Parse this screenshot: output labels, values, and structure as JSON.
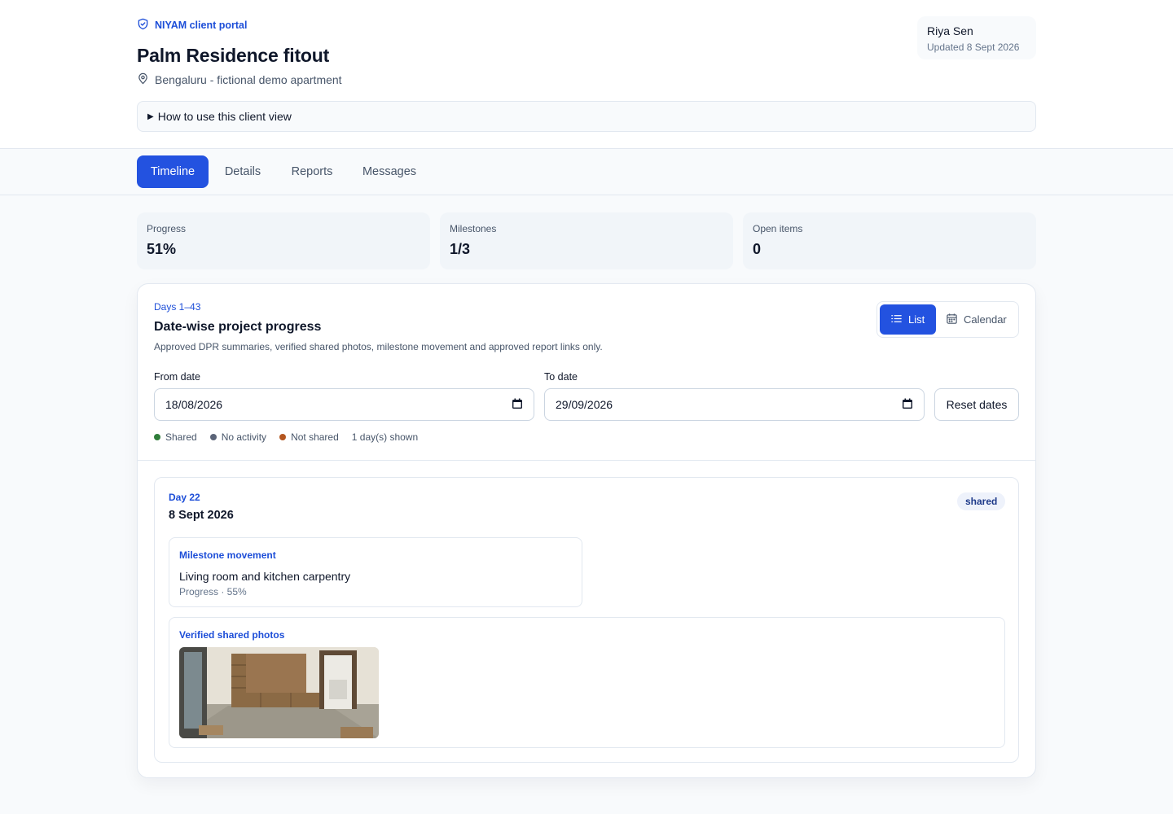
{
  "header": {
    "brand": "NIYAM client portal",
    "project_title": "Palm Residence fitout",
    "location": "Bengaluru - fictional demo apartment",
    "user_name": "Riya Sen",
    "updated": "Updated 8 Sept 2026",
    "howto": "How to use this client view"
  },
  "tabs": [
    {
      "label": "Timeline",
      "active": true
    },
    {
      "label": "Details",
      "active": false
    },
    {
      "label": "Reports",
      "active": false
    },
    {
      "label": "Messages",
      "active": false
    }
  ],
  "stats": [
    {
      "label": "Progress",
      "value": "51%"
    },
    {
      "label": "Milestones",
      "value": "1/3"
    },
    {
      "label": "Open items",
      "value": "0"
    }
  ],
  "panel": {
    "range": "Days 1–43",
    "title": "Date-wise project progress",
    "description": "Approved DPR summaries, verified shared photos, milestone movement and approved report links only.",
    "view_toggle": {
      "list": "List",
      "calendar": "Calendar",
      "selected": "List"
    },
    "from_label": "From date",
    "from_value": "18/08/2026",
    "to_label": "To date",
    "to_value": "29/09/2026",
    "reset_label": "Reset dates",
    "legend": [
      {
        "label": "Shared",
        "color": "#2f7d3a"
      },
      {
        "label": "No activity",
        "color": "#5b6478"
      },
      {
        "label": "Not shared",
        "color": "#b4561f"
      }
    ],
    "shown_count": "1 day(s) shown"
  },
  "day": {
    "label": "Day 22",
    "date": "8 Sept 2026",
    "badge": "shared",
    "milestone": {
      "label": "Milestone movement",
      "title": "Living room and kitchen carpentry",
      "progress": "Progress · 55%"
    },
    "photos_label": "Verified shared photos"
  },
  "colors": {
    "accent": "#2352e0",
    "link": "#1d4ed8"
  }
}
